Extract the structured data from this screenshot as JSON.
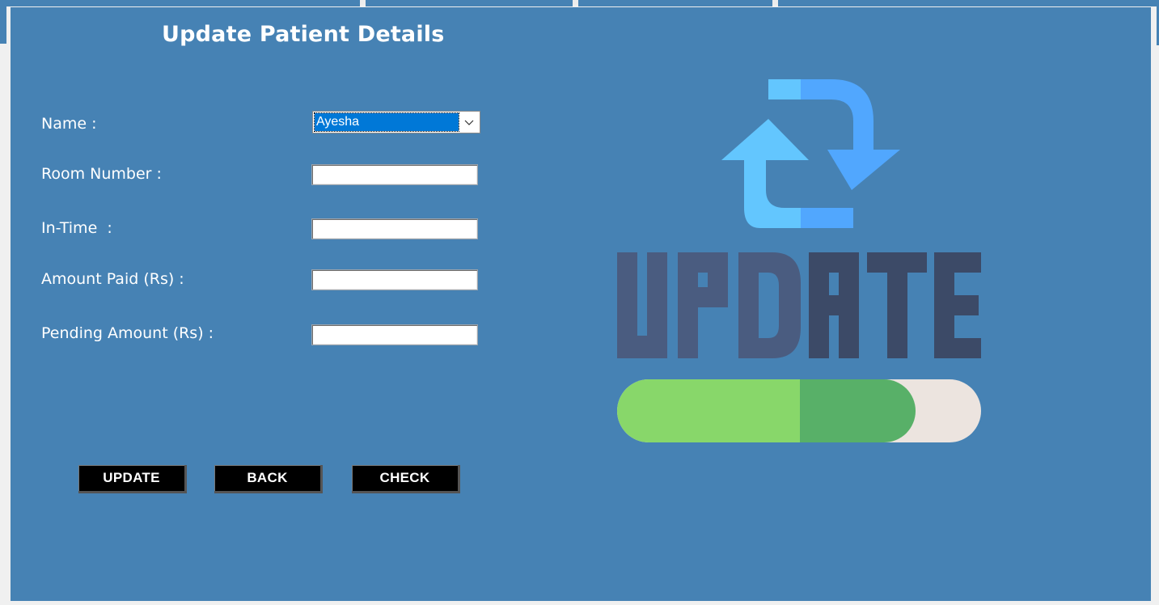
{
  "form": {
    "title": "Update Patient Details",
    "fields": [
      {
        "label": "Name :",
        "type": "select",
        "value": "Ayesha"
      },
      {
        "label": "Room Number :",
        "type": "text",
        "value": ""
      },
      {
        "label": "In-Time  :",
        "type": "text",
        "value": ""
      },
      {
        "label": "Amount Paid (Rs) :",
        "type": "text",
        "value": ""
      },
      {
        "label": "Pending Amount (Rs) :",
        "type": "text",
        "value": ""
      }
    ],
    "buttons": {
      "update": "UPDATE",
      "back": "BACK",
      "check": "CHECK"
    }
  },
  "illustration": {
    "icon": "refresh-arrows-icon",
    "progress_fraction": 0.82,
    "colors": {
      "panel_bg": "#4682b4",
      "arrow_light": "#63c6fe",
      "arrow_dark": "#51a7fe",
      "letters_light": "#4a5c80",
      "letters_dark": "#3c4a67",
      "bar_light": "#88d76a",
      "bar_dark": "#58b068",
      "bar_track": "#ece4df"
    }
  }
}
